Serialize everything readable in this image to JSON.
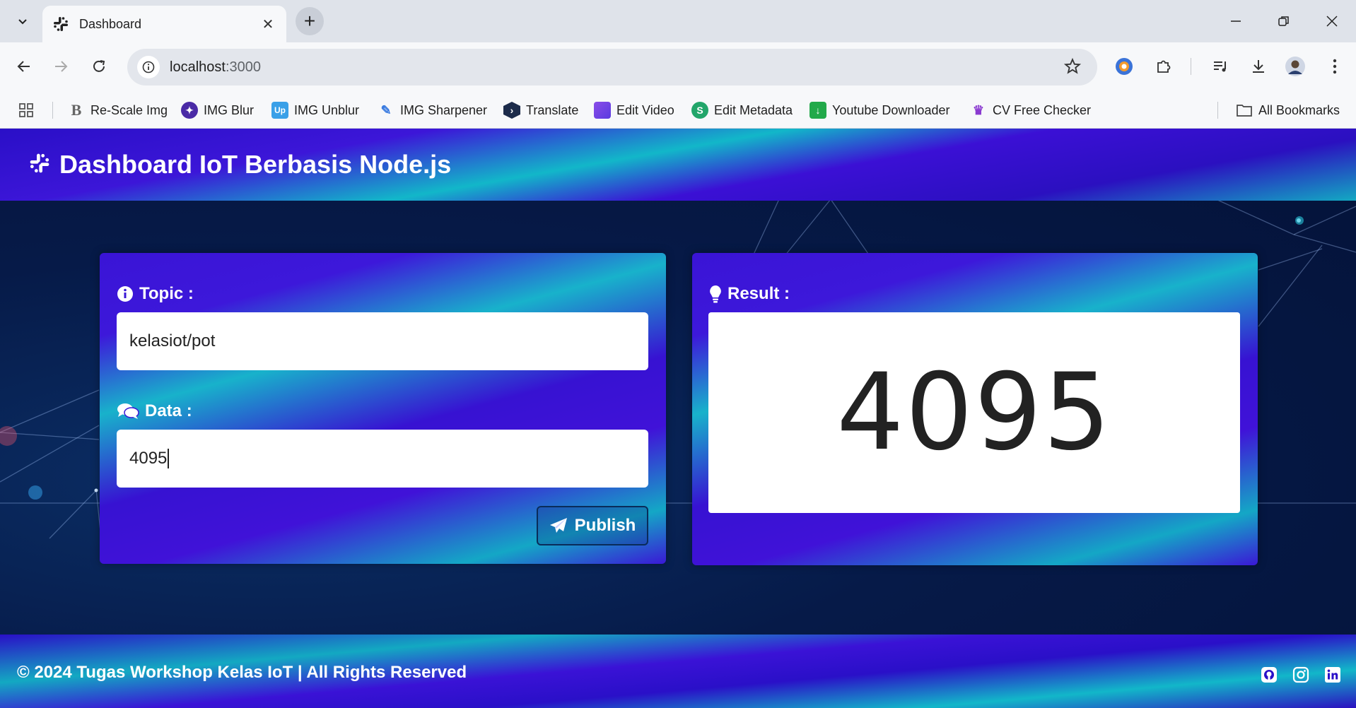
{
  "browser": {
    "tab_title": "Dashboard",
    "url_host": "localhost",
    "url_port": ":3000",
    "bookmarks": [
      {
        "label": "Re-Scale Img",
        "icon": "rescale-icon"
      },
      {
        "label": "IMG Blur",
        "icon": "img-blur-icon"
      },
      {
        "label": "IMG Unblur",
        "icon": "img-unblur-icon"
      },
      {
        "label": "IMG Sharpener",
        "icon": "img-sharpener-icon"
      },
      {
        "label": "Translate",
        "icon": "translate-icon"
      },
      {
        "label": "Edit Video",
        "icon": "edit-video-icon"
      },
      {
        "label": "Edit Metadata",
        "icon": "edit-metadata-icon"
      },
      {
        "label": "Youtube Downloader",
        "icon": "download-icon"
      },
      {
        "label": "CV Free Checker",
        "icon": "cv-checker-icon"
      }
    ],
    "all_bookmarks": "All Bookmarks"
  },
  "header": {
    "title": "Dashboard IoT Berbasis Node.js",
    "icon": "slack-icon"
  },
  "form": {
    "topic_label": "Topic :",
    "topic_value": "kelasiot/pot",
    "data_label": "Data :",
    "data_value": "4095",
    "publish_label": "Publish"
  },
  "result": {
    "label": "Result :",
    "value": "4095"
  },
  "footer": {
    "copyright": "© 2024 Tugas Workshop Kelas IoT | All Rights Reserved",
    "social_icons": [
      "github-icon",
      "instagram-icon",
      "linkedin-icon"
    ]
  },
  "colors": {
    "header_primary": "#3c16d8",
    "header_accent": "#12b7c9",
    "page_bg": "#061a48"
  }
}
